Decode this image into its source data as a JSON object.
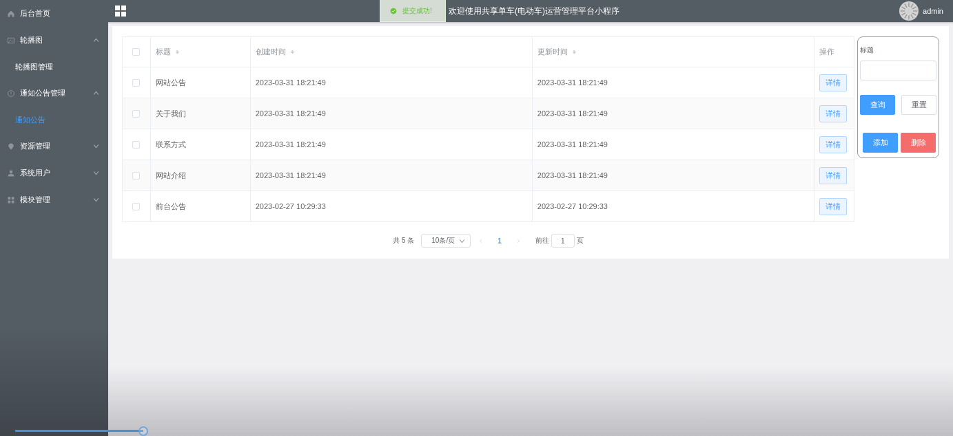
{
  "sidebar": {
    "items": [
      {
        "label": "后台首页"
      },
      {
        "label": "轮播图",
        "expanded": true,
        "children": [
          {
            "label": "轮播图管理",
            "selected": false
          }
        ]
      },
      {
        "label": "通知公告管理",
        "expanded": true,
        "children": [
          {
            "label": "通知公告",
            "selected": true
          }
        ]
      },
      {
        "label": "资源管理",
        "expanded": false
      },
      {
        "label": "系统用户",
        "expanded": false
      },
      {
        "label": "模块管理",
        "expanded": false
      }
    ]
  },
  "header": {
    "title": "欢迎使用共享单车(电动车)运营管理平台小程序",
    "user": "admin"
  },
  "toast": {
    "message": "提交成功!"
  },
  "table": {
    "select_all_checked": false,
    "columns": [
      {
        "label": "标题",
        "sortable": true
      },
      {
        "label": "创建时间",
        "sortable": true
      },
      {
        "label": "更新时间",
        "sortable": true
      },
      {
        "label": "操作",
        "sortable": false
      }
    ],
    "rows": [
      {
        "checked": false,
        "cells": [
          "网站公告",
          "2023-03-31 18:21:49",
          "2023-03-31 18:21:49"
        ],
        "action": "详情"
      },
      {
        "checked": false,
        "cells": [
          "关于我们",
          "2023-03-31 18:21:49",
          "2023-03-31 18:21:49"
        ],
        "action": "详情"
      },
      {
        "checked": false,
        "cells": [
          "联系方式",
          "2023-03-31 18:21:49",
          "2023-03-31 18:21:49"
        ],
        "action": "详情"
      },
      {
        "checked": false,
        "cells": [
          "网站介绍",
          "2023-03-31 18:21:49",
          "2023-03-31 18:21:49"
        ],
        "action": "详情"
      },
      {
        "checked": false,
        "cells": [
          "前台公告",
          "2023-02-27 10:29:33",
          "2023-02-27 10:29:33"
        ],
        "action": "详情"
      }
    ]
  },
  "pagination": {
    "total": "共 5 条",
    "page_size": "10条/页",
    "pages": [
      {
        "label": "1",
        "selected": true
      }
    ],
    "goto_label": "前往",
    "goto_value": "1",
    "goto_suffix": "页"
  },
  "search": {
    "label": "标题",
    "buttons": [
      {
        "label": "查询",
        "kind": "primary"
      },
      {
        "label": "重置",
        "kind": "default"
      },
      {
        "label": "添加",
        "kind": "primary"
      },
      {
        "label": "删除",
        "kind": "danger"
      }
    ]
  },
  "video": {
    "level": 0.137
  }
}
